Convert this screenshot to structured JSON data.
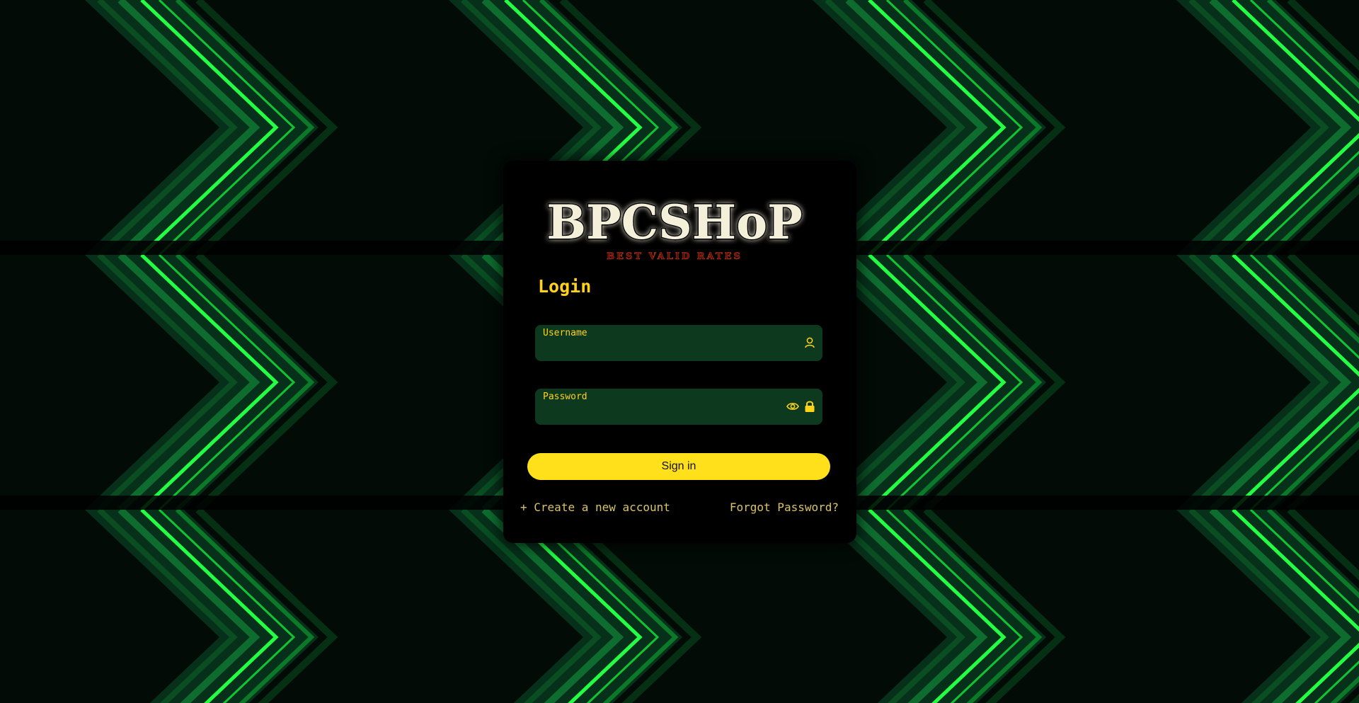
{
  "brand": {
    "name": "BPCSHoP",
    "tagline": "BEST VALID RATES"
  },
  "login": {
    "title": "Login",
    "username_label": "Username",
    "password_label": "Password",
    "signin_label": "Sign in",
    "create_prefix": "+",
    "create_label": "Create a new account",
    "forgot_label": "Forgot Password?"
  },
  "icons": {
    "username": "user-icon",
    "visibility": "eye-icon",
    "password": "lock-icon"
  },
  "colors": {
    "accent": "#ffd21a",
    "button": "#ffe01a",
    "field_bg": "#0d3a1f",
    "link": "#d9c36a",
    "background_glow": "#22ff44"
  }
}
